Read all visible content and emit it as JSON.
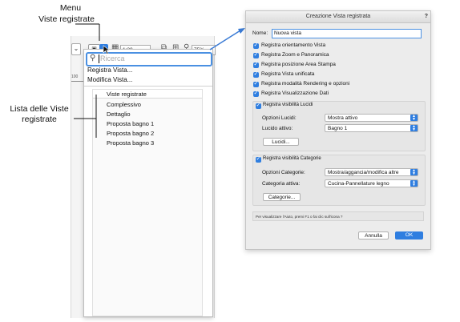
{
  "annotations": {
    "menu_line1": "Menu",
    "menu_line2": "Viste registrate",
    "list_line1": "Lista delle Viste",
    "list_line2": "registrate"
  },
  "toolbar": {
    "scale_value": "1:20",
    "zoom_value": "75%",
    "ruler_label": "100"
  },
  "menu": {
    "search_placeholder": "Ricerca",
    "items": [
      "Registra Vista...",
      "Modifica Vista..."
    ],
    "list_header": "Viste registrate",
    "views": [
      "Complessivo",
      "Dettaglio",
      "Proposta bagno 1",
      "Proposta bagno 2",
      "Proposta bagno 3"
    ]
  },
  "dialog": {
    "title": "Creazione Vista registrata",
    "help_button": "?",
    "name_label": "Nome:",
    "name_value": "Nuova vista",
    "options": [
      "Registra orientamento Vista",
      "Registra Zoom e Panoramica",
      "Registra posizione Area Stampa",
      "Registra Vista unificata",
      "Registra modalità Rendering e opzioni",
      "Registra Visualizzazione Dati"
    ],
    "layers": {
      "checkbox_label": "Registra visibilità Lucidi",
      "options_label": "Opzioni Lucidi:",
      "options_value": "Mostra attivo",
      "active_label": "Lucido attivo:",
      "active_value": "Bagno 1",
      "button": "Lucidi..."
    },
    "categories": {
      "checkbox_label": "Registra visibilità Categorie",
      "options_label": "Opzioni Categorie:",
      "options_value": "Mostra/aggancia/modifica altre",
      "active_label": "Categoria attiva:",
      "active_value": "Cucina-Pannellature legno",
      "button": "Categorie..."
    },
    "help_text": "Per visualizzare l'Aiuto, premi F1 o fai clic sull'icona ?",
    "cancel": "Annulla",
    "ok": "OK"
  },
  "colors": {
    "accent": "#2f7ee0",
    "arrow": "#3a7bd5"
  }
}
